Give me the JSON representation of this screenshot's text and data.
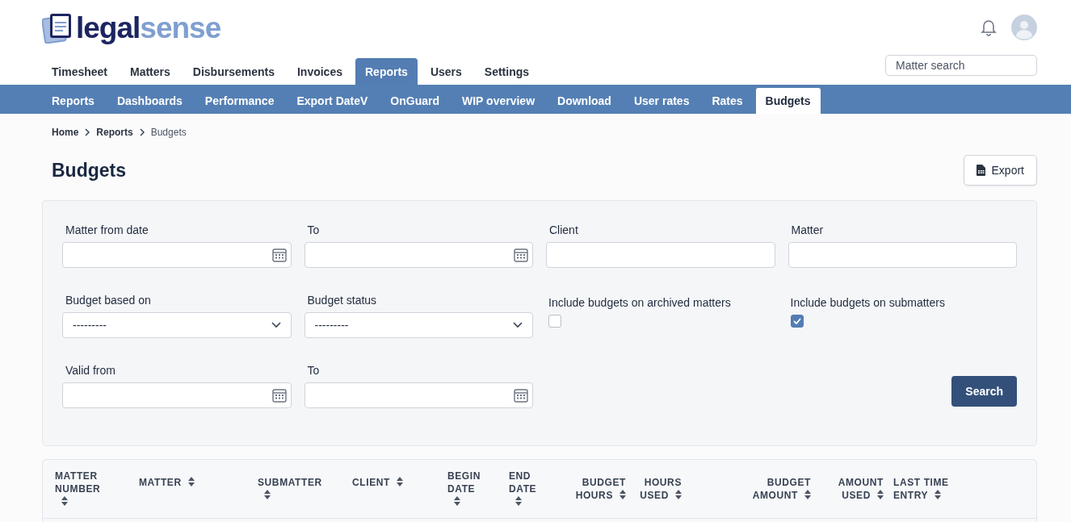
{
  "logo": {
    "primary": "legal",
    "secondary": "sense"
  },
  "main_nav": [
    {
      "label": "Timesheet",
      "selected": false
    },
    {
      "label": "Matters",
      "selected": false
    },
    {
      "label": "Disbursements",
      "selected": false
    },
    {
      "label": "Invoices",
      "selected": false
    },
    {
      "label": "Reports",
      "selected": true
    },
    {
      "label": "Users",
      "selected": false
    },
    {
      "label": "Settings",
      "selected": false
    }
  ],
  "matter_search": {
    "placeholder": "Matter search"
  },
  "sub_nav": [
    {
      "label": "Reports",
      "selected": false
    },
    {
      "label": "Dashboards",
      "selected": false
    },
    {
      "label": "Performance",
      "selected": false
    },
    {
      "label": "Export DateV",
      "selected": false
    },
    {
      "label": "OnGuard",
      "selected": false
    },
    {
      "label": "WIP overview",
      "selected": false
    },
    {
      "label": "Download",
      "selected": false
    },
    {
      "label": "User rates",
      "selected": false
    },
    {
      "label": "Rates",
      "selected": false
    },
    {
      "label": "Budgets",
      "selected": true
    }
  ],
  "breadcrumb": [
    "Home",
    "Reports",
    "Budgets"
  ],
  "page_title": "Budgets",
  "export_button": "Export",
  "filters": [
    {
      "kind": "date",
      "label": "Matter from date"
    },
    {
      "kind": "date",
      "label": "To"
    },
    {
      "kind": "text",
      "label": "Client"
    },
    {
      "kind": "text",
      "label": "Matter"
    },
    {
      "kind": "select",
      "label": "Budget based on",
      "value": "---------"
    },
    {
      "kind": "select",
      "label": "Budget status",
      "value": "---------"
    },
    {
      "kind": "checkbox",
      "label": "Include budgets on archived matters",
      "checked": false
    },
    {
      "kind": "checkbox",
      "label": "Include budgets on submatters",
      "checked": true
    },
    {
      "kind": "date",
      "label": "Valid from"
    },
    {
      "kind": "date",
      "label": "To"
    }
  ],
  "search_button": "Search",
  "table": {
    "columns": [
      "MATTER NUMBER",
      "MATTER",
      "SUBMATTER",
      "CLIENT",
      "BEGIN DATE",
      "END DATE",
      "BUDGET HOURS",
      "HOURS USED",
      "BUDGET AMOUNT",
      "AMOUNT USED",
      "LAST TIME ENTRY"
    ]
  }
}
